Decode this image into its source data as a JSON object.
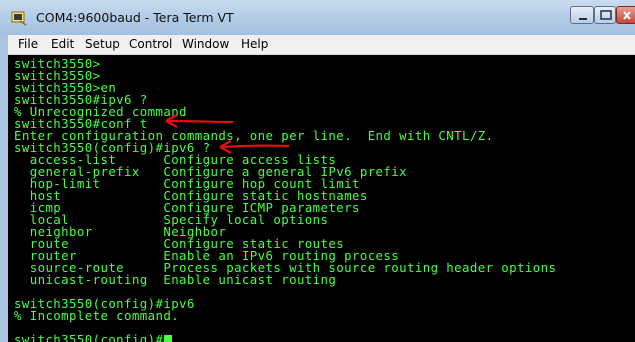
{
  "window": {
    "title": "COM4:9600baud - Tera Term VT",
    "controls": [
      "minimize-icon",
      "maximize-icon",
      "close-icon"
    ]
  },
  "menu": {
    "items": [
      "File",
      "Edit",
      "Setup",
      "Control",
      "Window",
      "Help"
    ]
  },
  "terminal": {
    "lines": [
      "switch3550>",
      "switch3550>",
      "switch3550>en",
      "switch3550#ipv6 ?",
      "% Unrecognized command",
      "switch3550#conf t",
      "Enter configuration commands, one per line.  End with CNTL/Z.",
      "switch3550(config)#ipv6 ?",
      "  access-list      Configure access lists",
      "  general-prefix   Configure a general IPv6 prefix",
      "  hop-limit        Configure hop count limit",
      "  host             Configure static hostnames",
      "  icmp             Configure ICMP parameters",
      "  local            Specify local options",
      "  neighbor         Neighbor",
      "  route            Configure static routes",
      "  router           Enable an IPv6 routing process",
      "  source-route     Process packets with source routing header options",
      "  unicast-routing  Enable unicast routing",
      "",
      "switch3550(config)#ipv6",
      "% Incomplete command.",
      "",
      "switch3550(config)#"
    ]
  },
  "colors": {
    "terminal_text": "#45ff42",
    "terminal_bg": "#000000",
    "annotation_arrow": "#e01010"
  }
}
